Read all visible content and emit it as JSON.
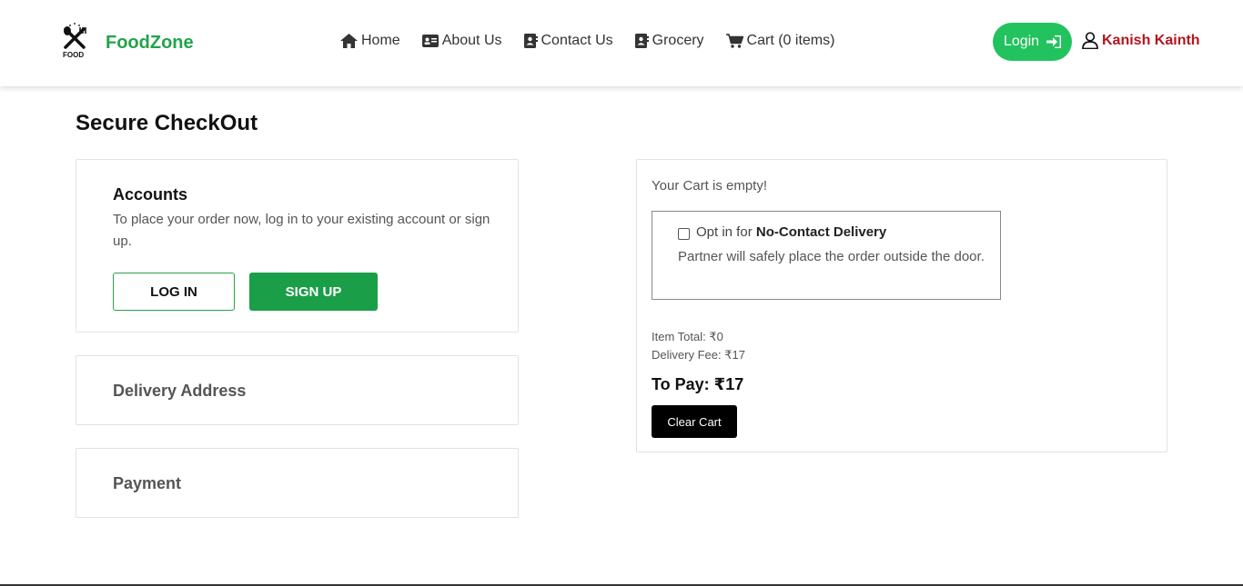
{
  "header": {
    "logo_text": "FOOD",
    "brand": "FoodZone",
    "nav": [
      {
        "label": "Home",
        "icon": "home-icon"
      },
      {
        "label": "About Us",
        "icon": "id-card-icon"
      },
      {
        "label": "Contact Us",
        "icon": "contact-book-icon"
      },
      {
        "label": "Grocery",
        "icon": "contact-book-icon"
      },
      {
        "label": "Cart (0 items)",
        "icon": "cart-icon"
      }
    ],
    "login_label": "Login",
    "user_name": "Kanish Kainth"
  },
  "page": {
    "title": "Secure CheckOut"
  },
  "accounts": {
    "heading": "Accounts",
    "description": "To place your order now, log in to your existing account or sign up.",
    "login_label": "LOG IN",
    "signup_label": "SIGN UP"
  },
  "delivery": {
    "label": "Delivery Address"
  },
  "payment": {
    "label": "Payment"
  },
  "cart": {
    "empty_text": "Your Cart is empty!",
    "opt_prefix": "Opt in for",
    "opt_bold": "No-Contact Delivery",
    "opt_description": "Partner will safely place the order outside the door.",
    "item_total": "Item Total: ₹0",
    "delivery_fee": "Delivery Fee: ₹17",
    "to_pay": "To Pay: ₹17",
    "clear_label": "Clear Cart"
  },
  "colors": {
    "brand": "#22a44a",
    "login_bg": "#22c35e",
    "user": "#b5141e",
    "signup_bg": "#1a9e47"
  }
}
